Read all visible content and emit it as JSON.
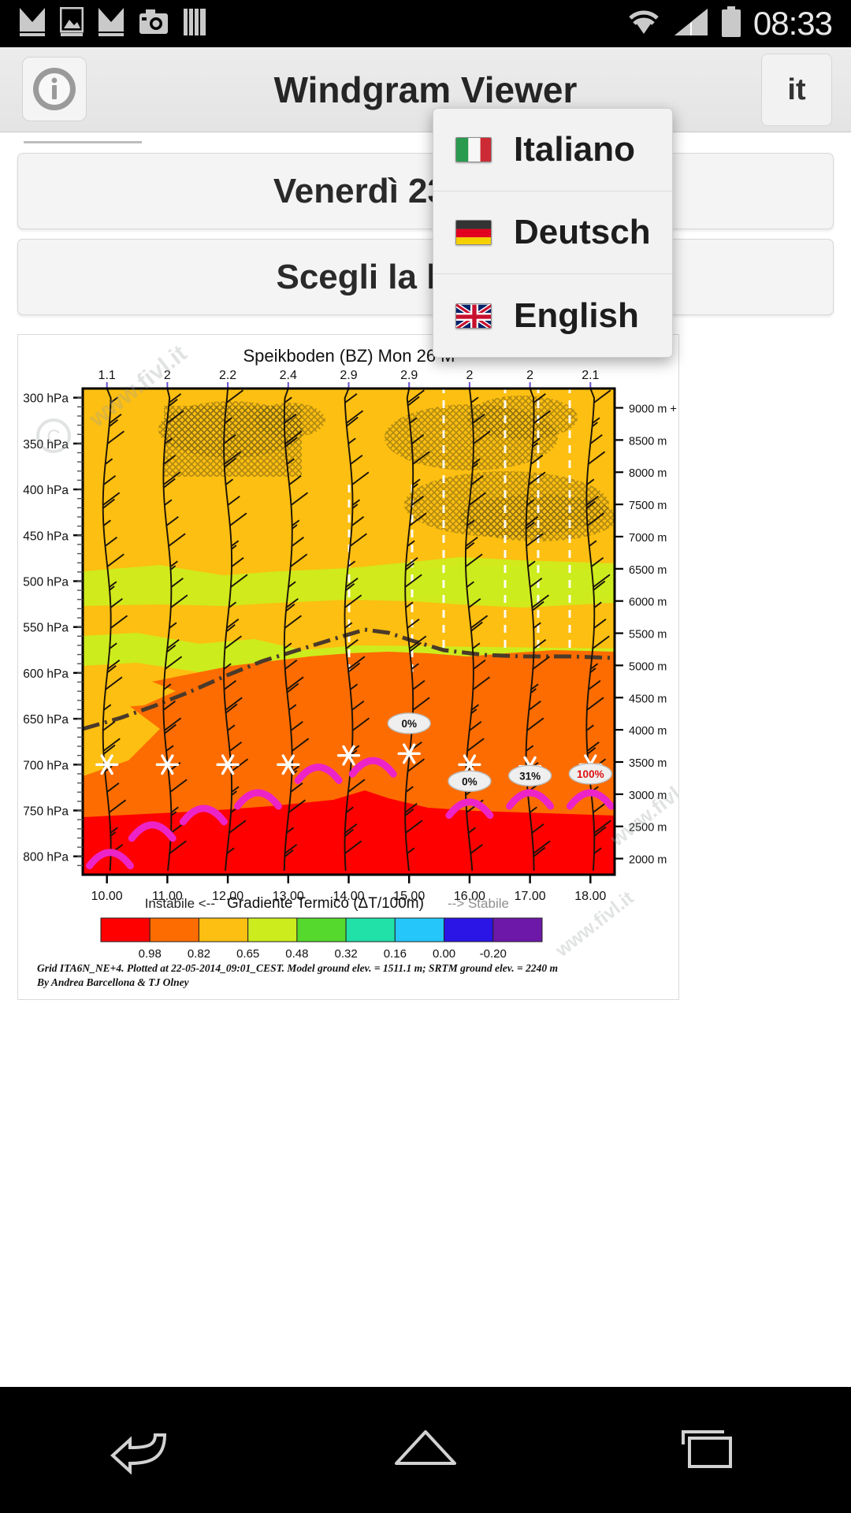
{
  "status_bar": {
    "time": "08:33",
    "icons": [
      "mail-icon",
      "image-icon",
      "mail-icon",
      "camera-icon",
      "book-icon",
      "wifi-icon",
      "signal-icon",
      "battery-icon"
    ]
  },
  "action_bar": {
    "info_label": "i",
    "title": "Windgram Viewer",
    "language_code": "it"
  },
  "selectors": {
    "date_label": "Venerdì 23 Maggio",
    "place_label": "Scegli la località..."
  },
  "language_menu": {
    "items": [
      {
        "label": "Italiano",
        "flag": "flag-it"
      },
      {
        "label": "Deutsch",
        "flag": "flag-de"
      },
      {
        "label": "English",
        "flag": "flag-gb"
      }
    ]
  },
  "chart_data": {
    "type": "heatmap",
    "title": "Speikboden (BZ) Mon 26 M",
    "xlabel": "",
    "ylabel": "",
    "grid": true,
    "legend_position": "bottom",
    "x_tick_labels": [
      "10.00",
      "11.00",
      "12.00",
      "13.00",
      "14.00",
      "15.00",
      "16.00",
      "17.00",
      "18.00"
    ],
    "x": [
      10,
      11,
      12,
      13,
      14,
      15,
      16,
      17,
      18
    ],
    "pressure_ticks": [
      "300 hPa",
      "350 hPa",
      "400 hPa",
      "450 hPa",
      "500 hPa",
      "550 hPa",
      "600 hPa",
      "650 hPa",
      "700 hPa",
      "750 hPa",
      "800 hPa"
    ],
    "pressure_values": [
      300,
      350,
      400,
      450,
      500,
      550,
      600,
      650,
      700,
      750,
      800
    ],
    "altitude_ticks": [
      "9000 m +",
      "8500 m",
      "8000 m",
      "7500 m",
      "7000 m",
      "6500 m",
      "6000 m",
      "5500 m",
      "5000 m",
      "4500 m",
      "4000 m",
      "3500 m",
      "3000 m",
      "2500 m",
      "2000 m"
    ],
    "altitude_values": [
      9000,
      8500,
      8000,
      7500,
      7000,
      6500,
      6000,
      5500,
      5000,
      4500,
      4000,
      3500,
      3000,
      2500,
      2000
    ],
    "top_wind_labels": [
      "1.1",
      "2",
      "2.2",
      "2.4",
      "2.9",
      "2.9",
      "2",
      "2",
      "2.1"
    ],
    "cloud_annotations": [
      {
        "text": "0%",
        "x": 15.0,
        "pressure": 655
      },
      {
        "text": "0%",
        "x": 16.0,
        "pressure": 718
      },
      {
        "text": "31%",
        "x": 17.0,
        "pressure": 712
      },
      {
        "text": "100%",
        "x": 18.0,
        "pressure": 710
      }
    ],
    "legend": {
      "left_text": "Instabile <--",
      "center_text": "Gradiente Termico (ΔT/100m)",
      "right_text": "--> Stabile",
      "tick_values": [
        "0.98",
        "0.82",
        "0.65",
        "0.48",
        "0.32",
        "0.16",
        "0.00",
        "-0.20"
      ],
      "colors": [
        "#fe0000",
        "#fd6c00",
        "#fdbf11",
        "#cdec1d",
        "#55d92c",
        "#21e0a8",
        "#25c6fa",
        "#2b14e6",
        "#6d18a8"
      ]
    },
    "footer_lines": [
      "Grid ITA6N_NE+4. Plotted at 22-05-2014_09:01_CEST. Model ground elev. = 1511.1 m; SRTM ground elev. = 2240 m",
      "By Andrea Barcellona & TJ Olney"
    ],
    "watermark": "www.fivl.it"
  },
  "nav_bar": {
    "items": [
      "back-icon",
      "home-icon",
      "recents-icon"
    ]
  }
}
